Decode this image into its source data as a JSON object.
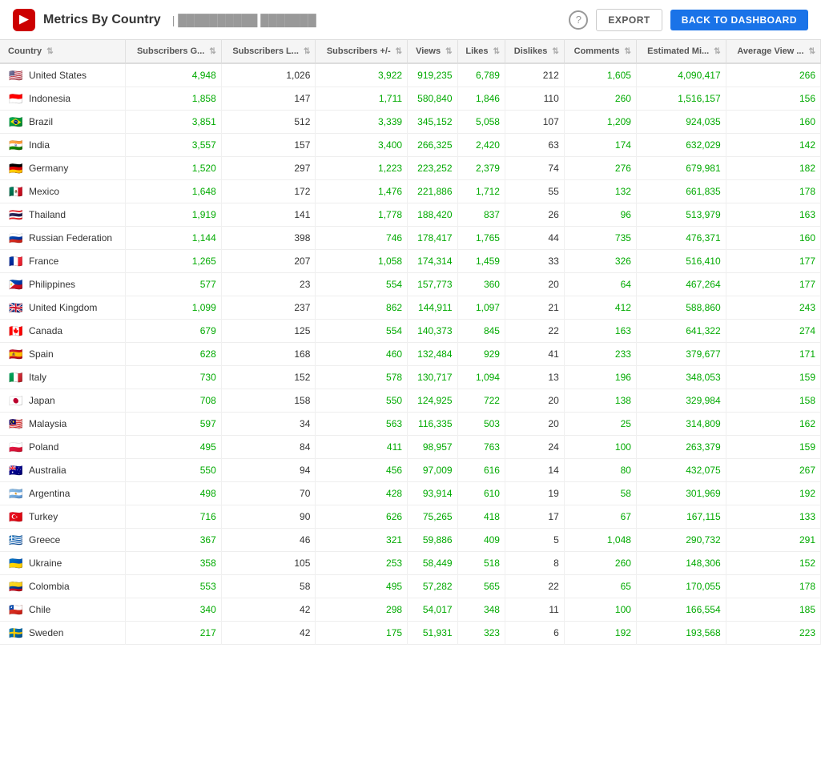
{
  "header": {
    "title": "Metrics By Country",
    "channel": "| ██████████ ███████",
    "help_label": "?",
    "export_label": "EXPORT",
    "dashboard_label": "BACK TO DASHBOARD"
  },
  "table": {
    "columns": [
      {
        "key": "country",
        "label": "Country"
      },
      {
        "key": "subs_gained",
        "label": "Subscribers G..."
      },
      {
        "key": "subs_lost",
        "label": "Subscribers L..."
      },
      {
        "key": "subs_net",
        "label": "Subscribers +/-"
      },
      {
        "key": "views",
        "label": "Views"
      },
      {
        "key": "likes",
        "label": "Likes"
      },
      {
        "key": "dislikes",
        "label": "Dislikes"
      },
      {
        "key": "comments",
        "label": "Comments"
      },
      {
        "key": "est_minutes",
        "label": "Estimated Mi..."
      },
      {
        "key": "avg_view",
        "label": "Average View ..."
      }
    ],
    "rows": [
      {
        "country": "United States",
        "flag": "🇺🇸",
        "subs_gained": "4,948",
        "subs_lost": "1,026",
        "subs_net": "3,922",
        "views": "919,235",
        "likes": "6,789",
        "dislikes": "212",
        "comments": "1,605",
        "est_minutes": "4,090,417",
        "avg_view": "266"
      },
      {
        "country": "Indonesia",
        "flag": "🇮🇩",
        "subs_gained": "1,858",
        "subs_lost": "147",
        "subs_net": "1,711",
        "views": "580,840",
        "likes": "1,846",
        "dislikes": "110",
        "comments": "260",
        "est_minutes": "1,516,157",
        "avg_view": "156"
      },
      {
        "country": "Brazil",
        "flag": "🇧🇷",
        "subs_gained": "3,851",
        "subs_lost": "512",
        "subs_net": "3,339",
        "views": "345,152",
        "likes": "5,058",
        "dislikes": "107",
        "comments": "1,209",
        "est_minutes": "924,035",
        "avg_view": "160"
      },
      {
        "country": "India",
        "flag": "🇮🇳",
        "subs_gained": "3,557",
        "subs_lost": "157",
        "subs_net": "3,400",
        "views": "266,325",
        "likes": "2,420",
        "dislikes": "63",
        "comments": "174",
        "est_minutes": "632,029",
        "avg_view": "142"
      },
      {
        "country": "Germany",
        "flag": "🇩🇪",
        "subs_gained": "1,520",
        "subs_lost": "297",
        "subs_net": "1,223",
        "views": "223,252",
        "likes": "2,379",
        "dislikes": "74",
        "comments": "276",
        "est_minutes": "679,981",
        "avg_view": "182"
      },
      {
        "country": "Mexico",
        "flag": "🇲🇽",
        "subs_gained": "1,648",
        "subs_lost": "172",
        "subs_net": "1,476",
        "views": "221,886",
        "likes": "1,712",
        "dislikes": "55",
        "comments": "132",
        "est_minutes": "661,835",
        "avg_view": "178"
      },
      {
        "country": "Thailand",
        "flag": "🇹🇭",
        "subs_gained": "1,919",
        "subs_lost": "141",
        "subs_net": "1,778",
        "views": "188,420",
        "likes": "837",
        "dislikes": "26",
        "comments": "96",
        "est_minutes": "513,979",
        "avg_view": "163"
      },
      {
        "country": "Russian Federation",
        "flag": "🇷🇺",
        "subs_gained": "1,144",
        "subs_lost": "398",
        "subs_net": "746",
        "views": "178,417",
        "likes": "1,765",
        "dislikes": "44",
        "comments": "735",
        "est_minutes": "476,371",
        "avg_view": "160"
      },
      {
        "country": "France",
        "flag": "🇫🇷",
        "subs_gained": "1,265",
        "subs_lost": "207",
        "subs_net": "1,058",
        "views": "174,314",
        "likes": "1,459",
        "dislikes": "33",
        "comments": "326",
        "est_minutes": "516,410",
        "avg_view": "177"
      },
      {
        "country": "Philippines",
        "flag": "🇵🇭",
        "subs_gained": "577",
        "subs_lost": "23",
        "subs_net": "554",
        "views": "157,773",
        "likes": "360",
        "dislikes": "20",
        "comments": "64",
        "est_minutes": "467,264",
        "avg_view": "177"
      },
      {
        "country": "United Kingdom",
        "flag": "🇬🇧",
        "subs_gained": "1,099",
        "subs_lost": "237",
        "subs_net": "862",
        "views": "144,911",
        "likes": "1,097",
        "dislikes": "21",
        "comments": "412",
        "est_minutes": "588,860",
        "avg_view": "243"
      },
      {
        "country": "Canada",
        "flag": "🇨🇦",
        "subs_gained": "679",
        "subs_lost": "125",
        "subs_net": "554",
        "views": "140,373",
        "likes": "845",
        "dislikes": "22",
        "comments": "163",
        "est_minutes": "641,322",
        "avg_view": "274"
      },
      {
        "country": "Spain",
        "flag": "🇪🇸",
        "subs_gained": "628",
        "subs_lost": "168",
        "subs_net": "460",
        "views": "132,484",
        "likes": "929",
        "dislikes": "41",
        "comments": "233",
        "est_minutes": "379,677",
        "avg_view": "171"
      },
      {
        "country": "Italy",
        "flag": "🇮🇹",
        "subs_gained": "730",
        "subs_lost": "152",
        "subs_net": "578",
        "views": "130,717",
        "likes": "1,094",
        "dislikes": "13",
        "comments": "196",
        "est_minutes": "348,053",
        "avg_view": "159"
      },
      {
        "country": "Japan",
        "flag": "🇯🇵",
        "subs_gained": "708",
        "subs_lost": "158",
        "subs_net": "550",
        "views": "124,925",
        "likes": "722",
        "dislikes": "20",
        "comments": "138",
        "est_minutes": "329,984",
        "avg_view": "158"
      },
      {
        "country": "Malaysia",
        "flag": "🇲🇾",
        "subs_gained": "597",
        "subs_lost": "34",
        "subs_net": "563",
        "views": "116,335",
        "likes": "503",
        "dislikes": "20",
        "comments": "25",
        "est_minutes": "314,809",
        "avg_view": "162"
      },
      {
        "country": "Poland",
        "flag": "🇵🇱",
        "subs_gained": "495",
        "subs_lost": "84",
        "subs_net": "411",
        "views": "98,957",
        "likes": "763",
        "dislikes": "24",
        "comments": "100",
        "est_minutes": "263,379",
        "avg_view": "159"
      },
      {
        "country": "Australia",
        "flag": "🇦🇺",
        "subs_gained": "550",
        "subs_lost": "94",
        "subs_net": "456",
        "views": "97,009",
        "likes": "616",
        "dislikes": "14",
        "comments": "80",
        "est_minutes": "432,075",
        "avg_view": "267"
      },
      {
        "country": "Argentina",
        "flag": "🇦🇷",
        "subs_gained": "498",
        "subs_lost": "70",
        "subs_net": "428",
        "views": "93,914",
        "likes": "610",
        "dislikes": "19",
        "comments": "58",
        "est_minutes": "301,969",
        "avg_view": "192"
      },
      {
        "country": "Turkey",
        "flag": "🇹🇷",
        "subs_gained": "716",
        "subs_lost": "90",
        "subs_net": "626",
        "views": "75,265",
        "likes": "418",
        "dislikes": "17",
        "comments": "67",
        "est_minutes": "167,115",
        "avg_view": "133"
      },
      {
        "country": "Greece",
        "flag": "🇬🇷",
        "subs_gained": "367",
        "subs_lost": "46",
        "subs_net": "321",
        "views": "59,886",
        "likes": "409",
        "dislikes": "5",
        "comments": "1,048",
        "est_minutes": "290,732",
        "avg_view": "291"
      },
      {
        "country": "Ukraine",
        "flag": "🇺🇦",
        "subs_gained": "358",
        "subs_lost": "105",
        "subs_net": "253",
        "views": "58,449",
        "likes": "518",
        "dislikes": "8",
        "comments": "260",
        "est_minutes": "148,306",
        "avg_view": "152"
      },
      {
        "country": "Colombia",
        "flag": "🇨🇴",
        "subs_gained": "553",
        "subs_lost": "58",
        "subs_net": "495",
        "views": "57,282",
        "likes": "565",
        "dislikes": "22",
        "comments": "65",
        "est_minutes": "170,055",
        "avg_view": "178"
      },
      {
        "country": "Chile",
        "flag": "🇨🇱",
        "subs_gained": "340",
        "subs_lost": "42",
        "subs_net": "298",
        "views": "54,017",
        "likes": "348",
        "dislikes": "11",
        "comments": "100",
        "est_minutes": "166,554",
        "avg_view": "185"
      },
      {
        "country": "Sweden",
        "flag": "🇸🇪",
        "subs_gained": "217",
        "subs_lost": "42",
        "subs_net": "175",
        "views": "51,931",
        "likes": "323",
        "dislikes": "6",
        "comments": "192",
        "est_minutes": "193,568",
        "avg_view": "223"
      }
    ]
  }
}
